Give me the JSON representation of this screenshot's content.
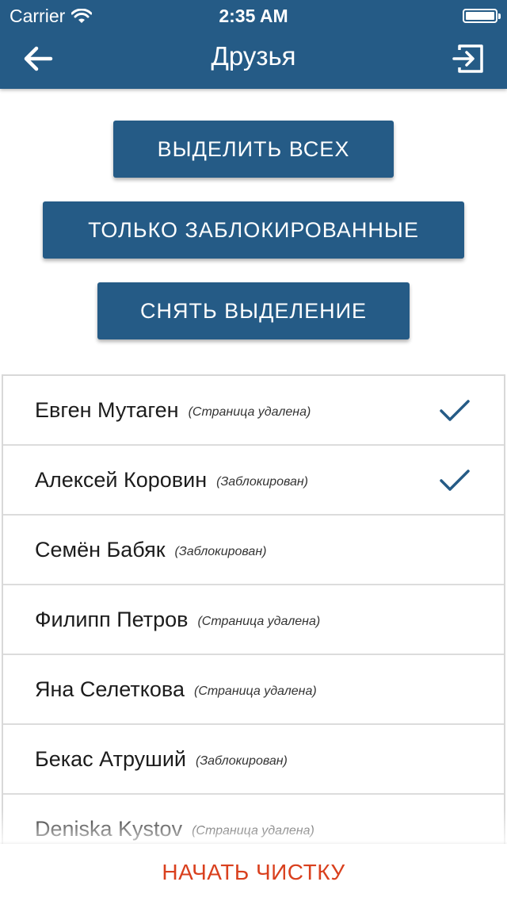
{
  "status_bar": {
    "carrier": "Carrier",
    "time": "2:35 AM",
    "wifi_icon": "wifi-icon",
    "battery_icon": "battery-icon"
  },
  "nav": {
    "title": "Друзья",
    "back_icon": "arrow-left-icon",
    "exit_icon": "exit-icon"
  },
  "actions": {
    "select_all": "ВЫДЕЛИТЬ ВСЕХ",
    "only_blocked": "ТОЛЬКО ЗАБЛОКИРОВАННЫЕ",
    "deselect": "СНЯТЬ ВЫДЕЛЕНИЕ"
  },
  "friends": [
    {
      "name": "Евген Мутаген",
      "note": "(Страница удалена)",
      "selected": true
    },
    {
      "name": "Алексей Коровин",
      "note": "(Заблокирован)",
      "selected": true
    },
    {
      "name": "Семён Бабяк",
      "note": "(Заблокирован)",
      "selected": false
    },
    {
      "name": "Филипп Петров",
      "note": "(Страница удалена)",
      "selected": false
    },
    {
      "name": "Яна Селеткова",
      "note": "(Страница удалена)",
      "selected": false
    },
    {
      "name": "Бекас Атруший",
      "note": "(Заблокирован)",
      "selected": false
    },
    {
      "name": "Deniska Kystov",
      "note": "(Страница удалена)",
      "selected": false
    }
  ],
  "bottom": {
    "start_label": "НАЧАТЬ ЧИСТКУ"
  },
  "colors": {
    "primary": "#255b86",
    "accent_red": "#d9401e",
    "check": "#255b86"
  }
}
